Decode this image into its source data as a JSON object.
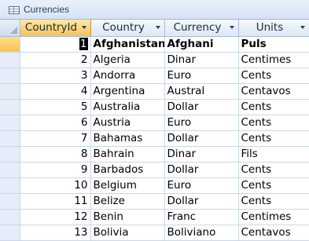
{
  "window": {
    "title": "Currencies",
    "icon": "table-icon"
  },
  "columns": [
    "CountryId",
    "Country",
    "Currency",
    "Units"
  ],
  "sorted_column": "CountryId",
  "current_row_index": 0,
  "rows": [
    {
      "id": "1",
      "country": "Afghanistan",
      "currency": "Afghani",
      "units": "Puls"
    },
    {
      "id": "2",
      "country": "Algeria",
      "currency": "Dinar",
      "units": "Centimes"
    },
    {
      "id": "3",
      "country": "Andorra",
      "currency": "Euro",
      "units": "Cents"
    },
    {
      "id": "4",
      "country": "Argentina",
      "currency": "Austral",
      "units": "Centavos"
    },
    {
      "id": "5",
      "country": "Australia",
      "currency": "Dollar",
      "units": "Cents"
    },
    {
      "id": "6",
      "country": "Austria",
      "currency": "Euro",
      "units": "Cents"
    },
    {
      "id": "7",
      "country": "Bahamas",
      "currency": "Dollar",
      "units": "Cents"
    },
    {
      "id": "8",
      "country": "Bahrain",
      "currency": "Dinar",
      "units": "Fils"
    },
    {
      "id": "9",
      "country": "Barbados",
      "currency": "Dollar",
      "units": "Cents"
    },
    {
      "id": "10",
      "country": "Belgium",
      "currency": "Euro",
      "units": "Cents"
    },
    {
      "id": "11",
      "country": "Belize",
      "currency": "Dollar",
      "units": "Cents"
    },
    {
      "id": "12",
      "country": "Benin",
      "currency": "Franc",
      "units": "Centimes"
    },
    {
      "id": "13",
      "country": "Bolivia",
      "currency": "Boliviano",
      "units": "Centavos"
    }
  ],
  "colors": {
    "header_sorted": "#f5c258",
    "header": "#dce7f5",
    "gridline": "#c9d7ea"
  }
}
